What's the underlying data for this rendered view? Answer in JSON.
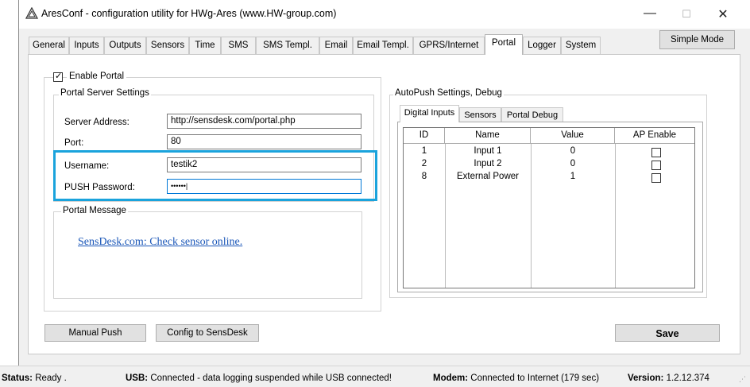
{
  "window": {
    "title": "AresConf - configuration utility for HWg-Ares (www.HW-group.com)",
    "minimize": "—",
    "maximize": "☐",
    "close": "✕"
  },
  "tabs": [
    "General",
    "Inputs",
    "Outputs",
    "Sensors",
    "Time",
    "SMS",
    "SMS Templ.",
    "Email",
    "Email Templ.",
    "GPRS/Internet",
    "Portal",
    "Logger",
    "System"
  ],
  "active_tab": "Portal",
  "simple_mode_label": "Simple Mode",
  "enable_portal": {
    "label": "Enable Portal",
    "checked": true
  },
  "server_settings": {
    "title": "Portal Server Settings",
    "server_address_label": "Server Address:",
    "server_address_value": "http://sensdesk.com/portal.php",
    "port_label": "Port:",
    "port_value": "80",
    "username_label": "Username:",
    "username_value": "testik2",
    "password_label": "PUSH Password:",
    "password_value": "••••••"
  },
  "portal_message": {
    "title": "Portal Message",
    "link_text": "SensDesk.com: Check sensor online."
  },
  "autopush": {
    "title": "AutoPush Settings, Debug",
    "tabs": [
      "Digital Inputs",
      "Sensors",
      "Portal Debug"
    ],
    "active_tab": "Digital Inputs",
    "columns": [
      "ID",
      "Name",
      "Value",
      "AP Enable"
    ],
    "rows": [
      {
        "id": "1",
        "name": "Input 1",
        "value": "0",
        "ap_enable": false
      },
      {
        "id": "2",
        "name": "Input 2",
        "value": "0",
        "ap_enable": false
      },
      {
        "id": "8",
        "name": "External Power",
        "value": "1",
        "ap_enable": false
      }
    ]
  },
  "buttons": {
    "manual_push": "Manual Push",
    "config_to_sensdesk": "Config to SensDesk",
    "save": "Save"
  },
  "status": {
    "status_label": "Status:",
    "status_value": "Ready .",
    "usb_label": "USB:",
    "usb_value": "Connected - data logging suspended while USB connected!",
    "modem_label": "Modem:",
    "modem_value": "Connected to Internet (179 sec)",
    "version_label": "Version:",
    "version_value": "1.2.12.374"
  },
  "colors": {
    "highlight": "#1aa3dc",
    "link": "#1a56b8",
    "focus": "#0078d7"
  }
}
